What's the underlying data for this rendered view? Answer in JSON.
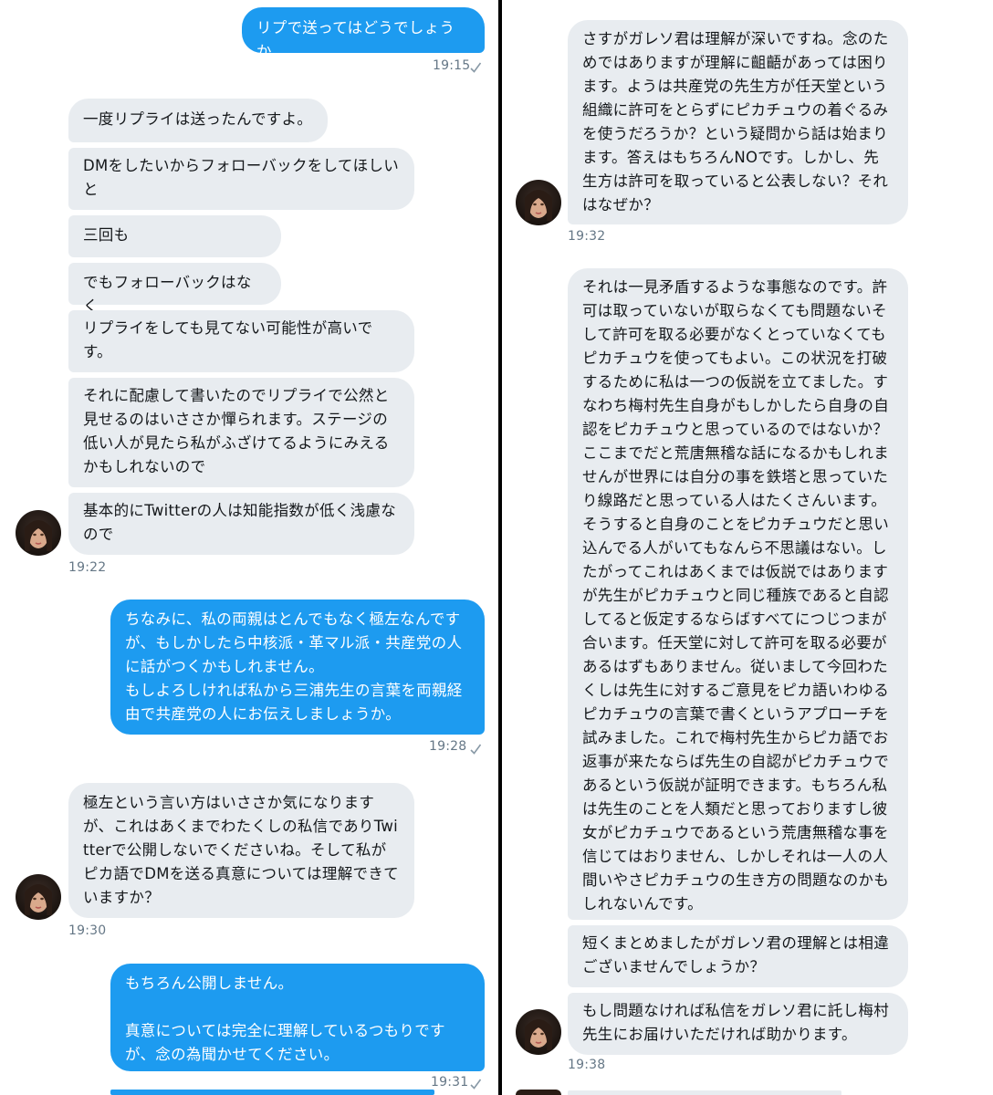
{
  "left": {
    "messages": [
      {
        "side": "out",
        "text": "リプで送ってはどうでしょうか"
      },
      {
        "side": "in",
        "text": "一度リプライは送ったんですよ。"
      },
      {
        "side": "in",
        "text": "DMをしたいからフォローバックをしてほしいと"
      },
      {
        "side": "in",
        "text": "三回も"
      },
      {
        "side": "in",
        "text": "でもフォローバックはなく"
      },
      {
        "side": "in",
        "text": "リプライをしても見てない可能性が高いです。"
      },
      {
        "side": "in",
        "text": "それに配慮して書いたのでリプライで公然と見せるのはいささか憚られます。ステージの低い人が見たら私がふざけてるようにみえるかもしれないので"
      },
      {
        "side": "in",
        "text": "基本的にTwitterの人は知能指数が低く浅慮なので"
      },
      {
        "side": "out",
        "text": "ちなみに、私の両親はとんでもなく極左なんですが、もしかしたら中核派・革マル派・共産党の人に話がつくかもしれません。\nもしよろしければ私から三浦先生の言葉を両親経由で共産党の人にお伝えしましょうか。"
      },
      {
        "side": "in",
        "text": "極左という言い方はいささか気になりますが、これはあくまでわたくしの私信でありTwitterで公開しないでくださいね。そして私がピカ語でDMを送る真意については理解できていますか？"
      },
      {
        "side": "out",
        "text": "もちろん公開しません。\n\n真意については完全に理解しているつもりですが、念の為聞かせてください。"
      }
    ],
    "timestamps": [
      "19:15",
      "19:22",
      "19:28",
      "19:30",
      "19:31"
    ]
  },
  "right": {
    "messages": [
      {
        "side": "in",
        "text": "さすがガレソ君は理解が深いですね。念のためではありますが理解に齟齬があっては困ります。ようは共産党の先生方が任天堂という組織に許可をとらずにピカチュウの着ぐるみを使うだろうか？という疑問から話は始まります。答えはもちろんNOです。しかし、先生方は許可を取っていると公表しない？それはなぜか？"
      },
      {
        "side": "in",
        "text": "それは一見矛盾するような事態なのです。許可は取っていないが取らなくても問題ないそして許可を取る必要がなくとっていなくてもピカチュウを使ってもよい。この状況を打破するために私は一つの仮説を立てました。すなわち梅村先生自身がもしかしたら自身の自認をピカチュウと思っているのではないか？ここまでだと荒唐無稽な話になるかもしれませんが世界には自分の事を鉄塔と思っていたり線路だと思っている人はたくさんいます。そうすると自身のことをピカチュウだと思い込んでる人がいてもなんら不思議はない。したがってこれはあくまでは仮説ではありますが先生がピカチュウと同じ種族であると自認してると仮定するならばすべてにつじつまが合います。任天堂に対して許可を取る必要があるはずもありません。従いまして今回わたくしは先生に対するご意見をピカ語いわゆるピカチュウの言葉で書くというアプローチを試みました。これで梅村先生からピカ語でお返事が来たならば先生の自認がピカチュウであるという仮説が証明できます。もちろん私は先生のことを人類だと思っておりますし彼女がピカチュウであるという荒唐無稽な事を信じてはおりません、しかしそれは一人の人間いやさピカチュウの生き方の問題なのかもしれないんです。"
      },
      {
        "side": "in",
        "text": "短くまとめましたがガレソ君の理解とは相違ございませんでしょうか？"
      },
      {
        "side": "in",
        "text": "もし問題なければ私信をガレソ君に託し梅村先生にお届けいただければ助かります。"
      }
    ],
    "timestamps": [
      "19:32",
      "19:38"
    ]
  },
  "colors": {
    "sent_bubble": "#1d9bf0",
    "received_bubble": "#e8ecf0",
    "timestamp": "#657786",
    "divider": "#000000"
  },
  "icons": {
    "read_receipt": "checkmark-icon",
    "contact_avatar": "avatar"
  }
}
